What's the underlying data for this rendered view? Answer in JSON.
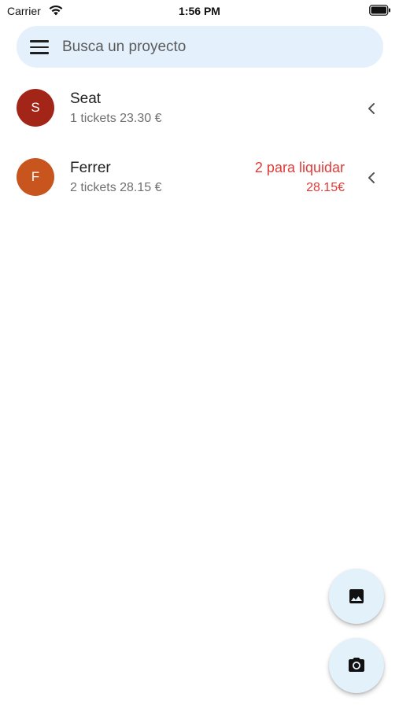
{
  "status_bar": {
    "carrier": "Carrier",
    "time": "1:56 PM",
    "wifi_icon": "wifi-icon",
    "battery_icon": "battery-icon"
  },
  "search": {
    "placeholder": "Busca un proyecto",
    "value": "",
    "menu_icon": "menu-icon"
  },
  "projects": [
    {
      "initial": "S",
      "name": "Seat",
      "summary": "1 tickets 23.30 €",
      "status": "",
      "amount": "",
      "avatar_color": "#a32518"
    },
    {
      "initial": "F",
      "name": "Ferrer",
      "summary": "2 tickets 28.15 €",
      "status": "2 para liquidar",
      "amount": "28.15€",
      "avatar_color": "#c8541e"
    }
  ],
  "fabs": [
    {
      "icon": "image-icon"
    },
    {
      "icon": "camera-icon"
    }
  ],
  "colors": {
    "accent_background": "#e4f1fc",
    "warning_text": "#e53935"
  }
}
